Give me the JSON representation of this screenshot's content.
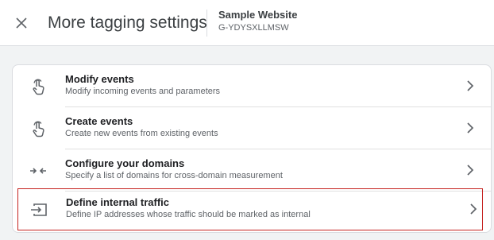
{
  "header": {
    "title": "More tagging settings",
    "site_name": "Sample Website",
    "site_id": "G-YDYSXLLMSW",
    "close_icon": "close-icon"
  },
  "settings": {
    "items": [
      {
        "title": "Modify events",
        "subtitle": "Modify incoming events and parameters",
        "icon": "touch-icon"
      },
      {
        "title": "Create events",
        "subtitle": "Create new events from existing events",
        "icon": "touch-icon"
      },
      {
        "title": "Configure your domains",
        "subtitle": "Specify a list of domains for cross-domain measurement",
        "icon": "arrows-merge-icon"
      },
      {
        "title": "Define internal traffic",
        "subtitle": "Define IP addresses whose traffic should be marked as internal",
        "icon": "input-icon",
        "selected": true
      }
    ]
  },
  "colors": {
    "selected_border": "#c5221f",
    "background": "#f1f3f4"
  }
}
